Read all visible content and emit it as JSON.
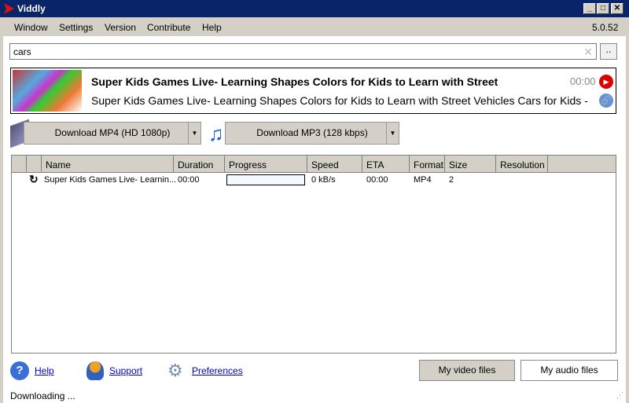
{
  "window": {
    "title": "Viddly",
    "version": "5.0.52"
  },
  "menu": [
    "Window",
    "Settings",
    "Version",
    "Contribute",
    "Help"
  ],
  "search": {
    "value": "cars",
    "browse_label": ".."
  },
  "video": {
    "title": "Super Kids Games Live- Learning Shapes  Colors for Kids to Learn with Street",
    "description": "Super Kids Games Live- Learning Shapes  Colors for Kids to Learn with Street Vehicles Cars for Kids  -",
    "duration": "00:00"
  },
  "download": {
    "mp4": "Download MP4 (HD 1080p)",
    "mp3": "Download MP3 (128 kbps)"
  },
  "table": {
    "columns": [
      "Name",
      "Duration",
      "Progress",
      "Speed",
      "ETA",
      "Format",
      "Size",
      "Resolution"
    ],
    "rows": [
      {
        "name": "Super Kids Games Live- Learnin...",
        "duration": "00:00",
        "progress": 0,
        "speed": "0 kB/s",
        "eta": "00:00",
        "format": "MP4",
        "size": "2",
        "resolution": ""
      }
    ]
  },
  "footer": {
    "help": "Help",
    "support": "Support",
    "preferences": "Preferences",
    "my_video": "My video files",
    "my_audio": "My audio files"
  },
  "status": "Downloading ..."
}
